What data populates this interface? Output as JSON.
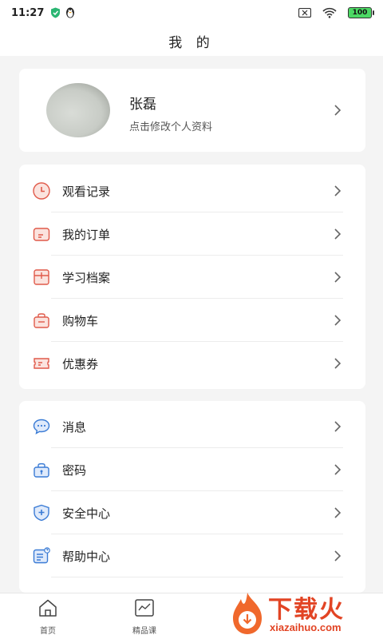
{
  "status_bar": {
    "time": "11:27",
    "icons": [
      "shield-icon",
      "penguin-icon",
      "no-sim-icon",
      "wifi-icon"
    ],
    "battery": "100"
  },
  "header": {
    "title": "我 的"
  },
  "profile": {
    "name": "张磊",
    "subtitle": "点击修改个人资料"
  },
  "menu_group_1": [
    {
      "label": "观看记录",
      "icon": "clock-icon"
    },
    {
      "label": "我的订单",
      "icon": "order-icon"
    },
    {
      "label": "学习档案",
      "icon": "archive-icon"
    },
    {
      "label": "购物车",
      "icon": "cart-bag-icon"
    },
    {
      "label": "优惠券",
      "icon": "coupon-icon"
    }
  ],
  "menu_group_2": [
    {
      "label": "消息",
      "icon": "message-icon"
    },
    {
      "label": "密码",
      "icon": "lock-icon"
    },
    {
      "label": "安全中心",
      "icon": "security-shield-icon"
    },
    {
      "label": "帮助中心",
      "icon": "help-icon"
    }
  ],
  "bottom_nav": [
    {
      "label": "首页",
      "icon": "home-icon"
    },
    {
      "label": "精品课",
      "icon": "chart-icon"
    }
  ],
  "watermark": {
    "title": "下载火",
    "url": "xiazaihuo.com"
  },
  "colors": {
    "accent_red": "#e05a4a",
    "accent_blue": "#3a7bd5",
    "watermark": "#e24424"
  }
}
